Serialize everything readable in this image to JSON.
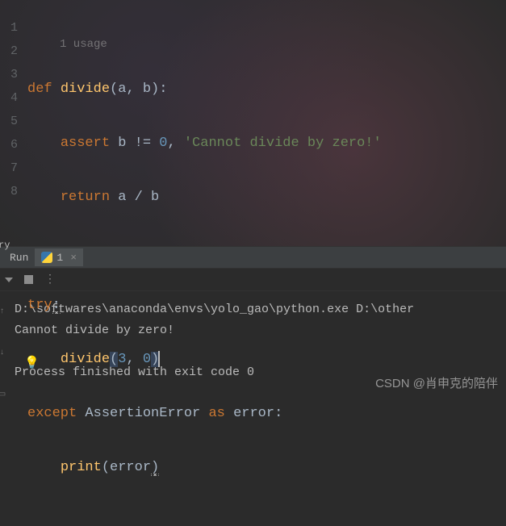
{
  "editor": {
    "usage_hint": "1 usage",
    "lines": [
      "1",
      "2",
      "3",
      "4",
      "5",
      "6",
      "7",
      "8"
    ],
    "code": {
      "l1": {
        "kw_def": "def ",
        "fn": "divide",
        "p1": "(",
        "a": "a",
        "c1": ", ",
        "b": "b",
        "p2": ")",
        "colon": ":"
      },
      "l2": {
        "kw": "assert ",
        "b": "b ",
        "op": "!= ",
        "zero": "0",
        "comma": ", ",
        "str": "'Cannot divide by zero!'"
      },
      "l3": {
        "kw": "return ",
        "expr": "a / b"
      },
      "l5": {
        "kw": "try",
        "colon": ":"
      },
      "l6": {
        "fn": "divide",
        "p1": "(",
        "a": "3",
        "c": ", ",
        "b": "0",
        "p2": ")"
      },
      "l7": {
        "kw1": "except ",
        "cls": "AssertionError ",
        "kw2": "as ",
        "err": "error",
        "colon": ":"
      },
      "l8": {
        "fn": "print",
        "p1": "(",
        "arg": "error",
        "p2": ")"
      }
    }
  },
  "sideTab": "ry",
  "toolWindow": {
    "run_label": "Run",
    "tab_name": "1",
    "close": "×"
  },
  "console": {
    "line1": "D:\\softwares\\anaconda\\envs\\yolo_gao\\python.exe D:\\other",
    "line2": "Cannot divide by zero!",
    "line3": "",
    "line4": "Process finished with exit code 0"
  },
  "watermark": "CSDN @肖申克的陪伴"
}
